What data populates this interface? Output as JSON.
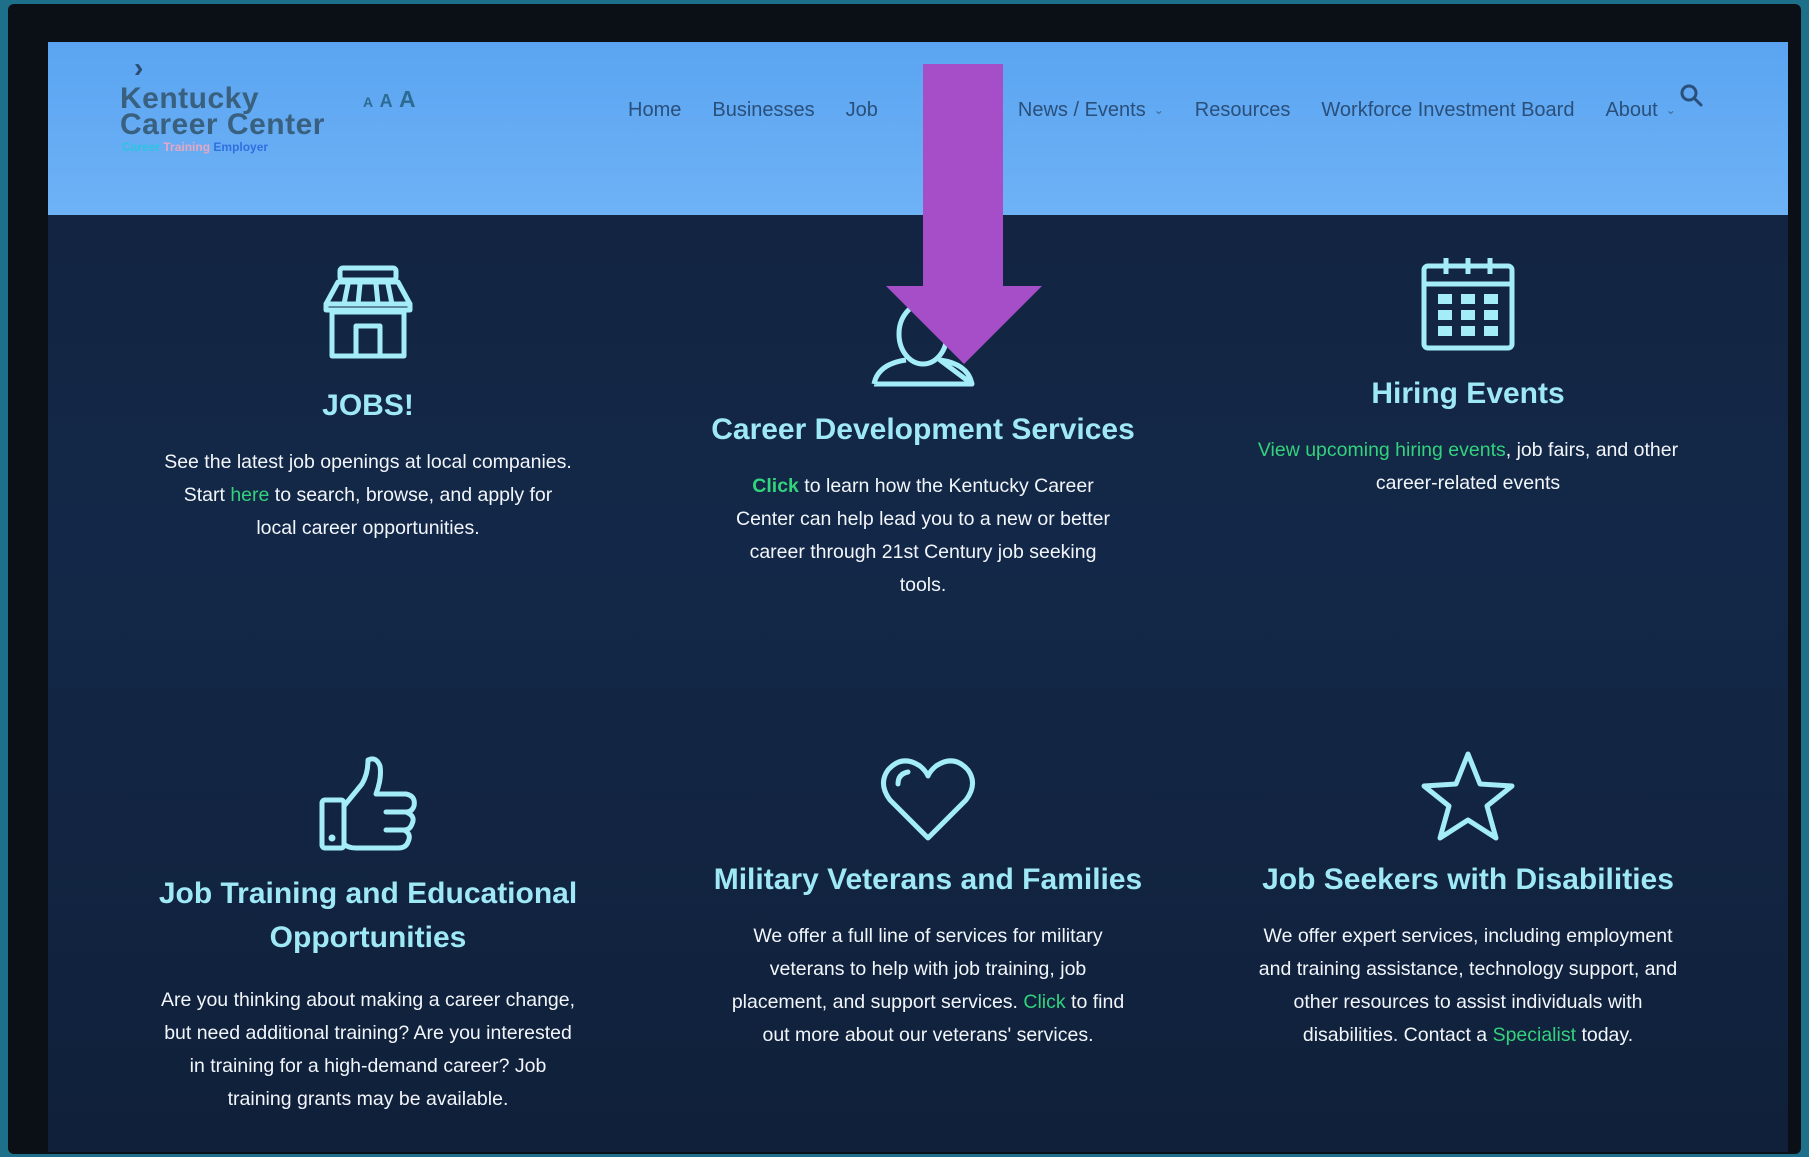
{
  "header": {
    "logo": {
      "line1": "Kentucky",
      "line2": "Career Center",
      "tag": [
        "Career",
        "Training",
        "Employer"
      ]
    },
    "font_sizer": [
      "A",
      "A",
      "A"
    ],
    "nav": [
      {
        "label": "Home"
      },
      {
        "label": "Businesses"
      },
      {
        "label": "Job"
      },
      {
        "label": "News / Events"
      },
      {
        "label": "Resources"
      },
      {
        "label": "Workforce Investment Board"
      },
      {
        "label": "About"
      }
    ]
  },
  "cards": [
    {
      "icon": "store-icon",
      "title": "JOBS!",
      "body": [
        "See the latest job openings at local companies. Start ",
        "here",
        " to search, browse, and apply for local career opportunities."
      ]
    },
    {
      "icon": "person-icon",
      "title": "Career Development Services",
      "body": [
        "Click",
        " to learn how the Kentucky Career Center can help lead you to a new or better career through 21st Century job seeking tools."
      ]
    },
    {
      "icon": "calendar-icon",
      "title": "Hiring Events",
      "body": [
        "View upcoming hiring events",
        ", job fairs, and other career-related events"
      ]
    },
    {
      "icon": "thumbs-up-icon",
      "title": "Job Training and Educational Opportunities",
      "body": [
        "Are you thinking about making a career change, but need additional training? Are you interested in training for a high-demand career? Job training grants may be available."
      ]
    },
    {
      "icon": "heart-icon",
      "title": "Military Veterans and Families",
      "body": [
        "We offer a full line of services for military veterans to help with job training, job placement, and support services. ",
        "Click",
        " to find out more about our veterans' services."
      ]
    },
    {
      "icon": "star-icon",
      "title": "Job Seekers with Disabilities",
      "body": [
        "We offer expert services, including employment and training assistance, technology support, and other resources to assist individuals with disabilities. Contact a ",
        "Specialist",
        " today."
      ]
    }
  ],
  "colors": {
    "header_bg": "#6eb2f6",
    "page_bg": "#132848",
    "title": "#9fe8f6",
    "link": "#33d27c",
    "arrow": "#a64dc8"
  }
}
